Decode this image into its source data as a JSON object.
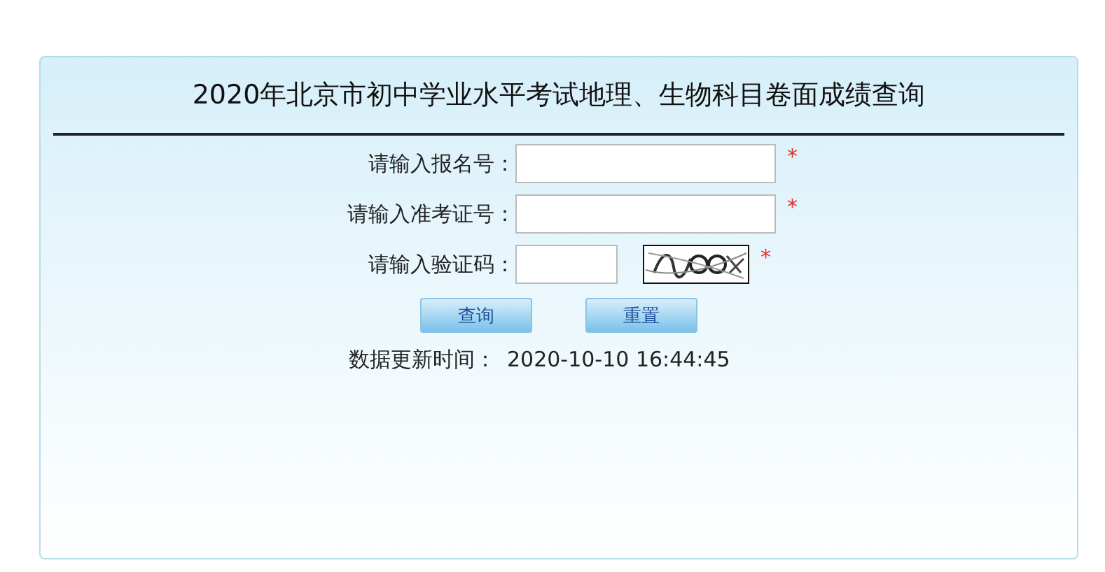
{
  "title": "2020年北京市初中学业水平考试地理、生物科目卷面成绩查询",
  "fields": [
    {
      "kind": "text",
      "label": "请输入报名号：",
      "required_mark": "*"
    },
    {
      "kind": "text",
      "label": "请输入准考证号：",
      "required_mark": "*"
    },
    {
      "kind": "captcha",
      "label": "请输入验证码：",
      "required_mark": "*"
    }
  ],
  "buttons": [
    "查询",
    "重置"
  ],
  "update_time": {
    "label": "数据更新时间：",
    "value": "2020-10-10 16:44:45"
  }
}
